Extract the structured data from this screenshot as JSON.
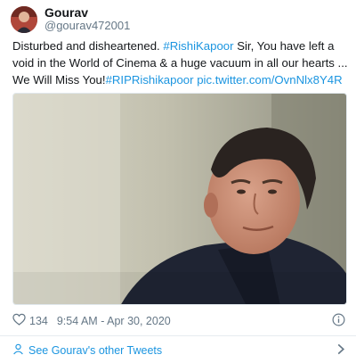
{
  "author": {
    "display_name": "Gourav",
    "handle": "@gourav472001"
  },
  "tweet": {
    "text_1": "Disturbed and disheartened. ",
    "hashtag_1": "#RishiKapoor",
    "text_2": " Sir, You have left a void in the World of Cinema & a huge vacuum in all our hearts ... We Will Miss You!",
    "hashtag_2": "#RIPRishikapoor",
    "text_3": " ",
    "link": "pic.twitter.com/OvnNlx8Y4R"
  },
  "meta": {
    "likes": "134",
    "timestamp": "9:54 AM - Apr 30, 2020"
  },
  "footer": {
    "other_tweets_label": "See Gourav's other Tweets"
  },
  "colors": {
    "link": "#1b95e0",
    "muted": "#657786",
    "text": "#14171a"
  },
  "icons": {
    "like": "heart-icon",
    "info": "info-icon",
    "profile": "person-icon",
    "chevron": "chevron-right-icon"
  }
}
